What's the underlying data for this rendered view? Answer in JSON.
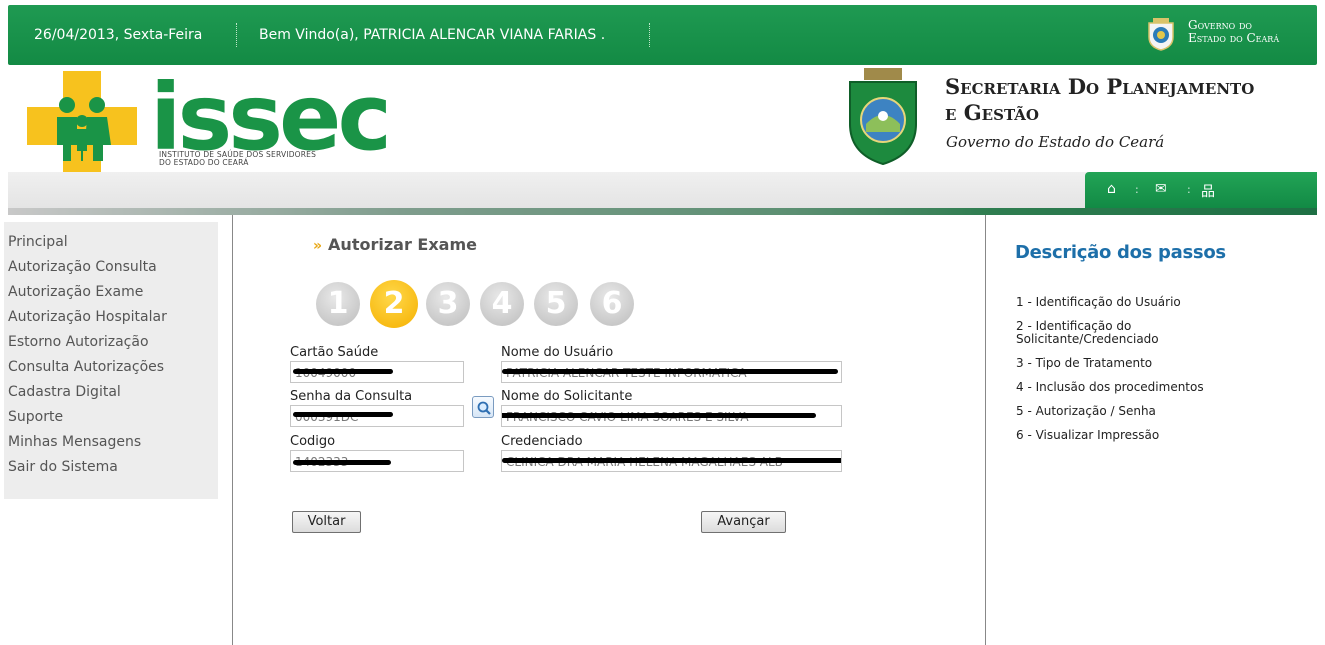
{
  "topbar": {
    "date": "26/04/2013, Sexta-Feira",
    "welcome": "Bem Vindo(a), PATRICIA ALENCAR VIANA FARIAS .",
    "gov_line1": "Governo do",
    "gov_line2": "Estado do Ceará"
  },
  "header": {
    "issec_logo": "issec",
    "issec_sub1": "INSTITUTO DE SAÚDE DOS SERVIDORES",
    "issec_sub2": "DO ESTADO DO CEARÁ",
    "secretaria_line1": "Secretaria Do Planejamento",
    "secretaria_line2": "e Gestão",
    "governo": "Governo do Estado do Ceará"
  },
  "toolbar": {
    "icons": [
      "home-icon",
      "mail-icon",
      "sitemap-icon"
    ]
  },
  "menu": {
    "items": [
      "Principal",
      "Autorização Consulta",
      "Autorização Exame",
      "Autorização Hospitalar",
      "Estorno Autorização",
      "Consulta Autorizações",
      "Cadastra Digital",
      "Suporte",
      "Minhas Mensagens",
      "Sair do Sistema"
    ]
  },
  "main": {
    "title": "Autorizar Exame",
    "steps": [
      "1",
      "2",
      "3",
      "4",
      "5",
      "6"
    ],
    "active_step": 2,
    "fields": {
      "cartao_label": "Cartão Saúde",
      "cartao_value": "10049000",
      "nome_usuario_label": "Nome do Usuário",
      "nome_usuario_value": "PATRICIA ALENCAR TESTE INFORMATICA",
      "senha_label": "Senha da Consulta",
      "senha_value": "000391DC",
      "nome_solicitante_label": "Nome do Solicitante",
      "nome_solicitante_value": "FRANCISCO CAVIO LIMA SOARES E SILVA",
      "codigo_label": "Codigo",
      "codigo_value": "1402333",
      "credenciado_label": "Credenciado",
      "credenciado_value": "CLINICA DRA MARIA HELENA MAGALHAES ALB"
    },
    "back_label": "Voltar",
    "next_label": "Avançar"
  },
  "description": {
    "title": "Descrição dos passos",
    "steps": [
      "1 - Identificação do Usuário",
      "2 - Identificação do Solicitante/Credenciado",
      "3 - Tipo de Tratamento",
      "4 - Inclusão dos procedimentos",
      "5 - Autorização / Senha",
      "6 - Visualizar Impressão"
    ]
  }
}
